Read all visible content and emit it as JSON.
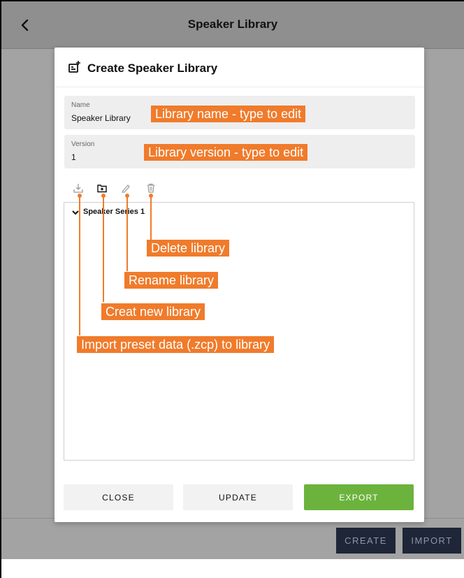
{
  "topbar": {
    "title": "Speaker Library"
  },
  "modal": {
    "title": "Create Speaker Library",
    "name_field": {
      "label": "Name",
      "value": "Speaker Library"
    },
    "version_field": {
      "label": "Version",
      "value": "1"
    },
    "toolbar": [
      "download-icon",
      "folder-plus-icon",
      "pencil-icon",
      "trash-icon"
    ],
    "tree": {
      "items": [
        {
          "label": "Speaker Series 1",
          "expanded": true
        }
      ]
    },
    "buttons": {
      "close": "CLOSE",
      "update": "UPDATE",
      "export": "EXPORT"
    }
  },
  "background_buttons": {
    "create": "CREATE",
    "import": "IMPORT"
  },
  "annotations": {
    "name_hint": "Library name - type to edit",
    "version_hint": "Library version - type to edit",
    "delete": "Delete library",
    "rename": "Rename library",
    "create_new": "Creat new library",
    "import": "Import preset data (.zcp) to library"
  },
  "colors": {
    "accent": "#6cb33e",
    "annotation": "#f07b2b",
    "dark_button": "#1e2638"
  }
}
